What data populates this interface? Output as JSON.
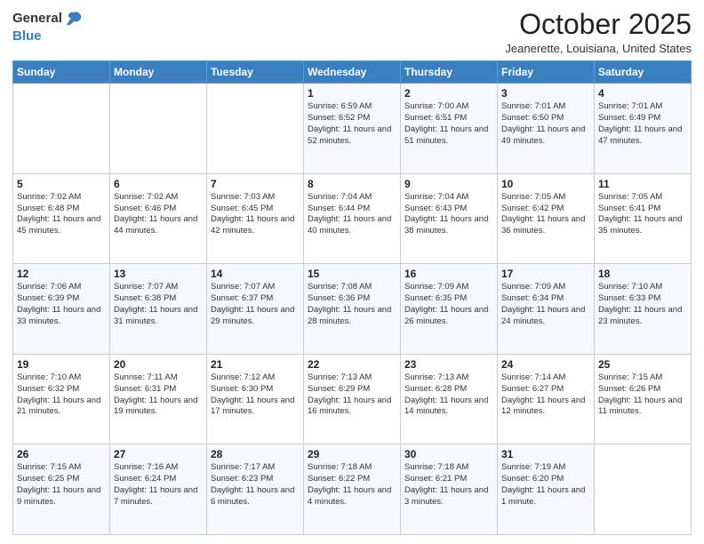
{
  "header": {
    "logo_general": "General",
    "logo_blue": "Blue",
    "month": "October 2025",
    "location": "Jeanerette, Louisiana, United States"
  },
  "weekdays": [
    "Sunday",
    "Monday",
    "Tuesday",
    "Wednesday",
    "Thursday",
    "Friday",
    "Saturday"
  ],
  "weeks": [
    [
      {
        "day": "",
        "info": ""
      },
      {
        "day": "",
        "info": ""
      },
      {
        "day": "",
        "info": ""
      },
      {
        "day": "1",
        "info": "Sunrise: 6:59 AM\nSunset: 6:52 PM\nDaylight: 11 hours and 52 minutes."
      },
      {
        "day": "2",
        "info": "Sunrise: 7:00 AM\nSunset: 6:51 PM\nDaylight: 11 hours and 51 minutes."
      },
      {
        "day": "3",
        "info": "Sunrise: 7:01 AM\nSunset: 6:50 PM\nDaylight: 11 hours and 49 minutes."
      },
      {
        "day": "4",
        "info": "Sunrise: 7:01 AM\nSunset: 6:49 PM\nDaylight: 11 hours and 47 minutes."
      }
    ],
    [
      {
        "day": "5",
        "info": "Sunrise: 7:02 AM\nSunset: 6:48 PM\nDaylight: 11 hours and 45 minutes."
      },
      {
        "day": "6",
        "info": "Sunrise: 7:02 AM\nSunset: 6:46 PM\nDaylight: 11 hours and 44 minutes."
      },
      {
        "day": "7",
        "info": "Sunrise: 7:03 AM\nSunset: 6:45 PM\nDaylight: 11 hours and 42 minutes."
      },
      {
        "day": "8",
        "info": "Sunrise: 7:04 AM\nSunset: 6:44 PM\nDaylight: 11 hours and 40 minutes."
      },
      {
        "day": "9",
        "info": "Sunrise: 7:04 AM\nSunset: 6:43 PM\nDaylight: 11 hours and 38 minutes."
      },
      {
        "day": "10",
        "info": "Sunrise: 7:05 AM\nSunset: 6:42 PM\nDaylight: 11 hours and 36 minutes."
      },
      {
        "day": "11",
        "info": "Sunrise: 7:05 AM\nSunset: 6:41 PM\nDaylight: 11 hours and 35 minutes."
      }
    ],
    [
      {
        "day": "12",
        "info": "Sunrise: 7:06 AM\nSunset: 6:39 PM\nDaylight: 11 hours and 33 minutes."
      },
      {
        "day": "13",
        "info": "Sunrise: 7:07 AM\nSunset: 6:38 PM\nDaylight: 11 hours and 31 minutes."
      },
      {
        "day": "14",
        "info": "Sunrise: 7:07 AM\nSunset: 6:37 PM\nDaylight: 11 hours and 29 minutes."
      },
      {
        "day": "15",
        "info": "Sunrise: 7:08 AM\nSunset: 6:36 PM\nDaylight: 11 hours and 28 minutes."
      },
      {
        "day": "16",
        "info": "Sunrise: 7:09 AM\nSunset: 6:35 PM\nDaylight: 11 hours and 26 minutes."
      },
      {
        "day": "17",
        "info": "Sunrise: 7:09 AM\nSunset: 6:34 PM\nDaylight: 11 hours and 24 minutes."
      },
      {
        "day": "18",
        "info": "Sunrise: 7:10 AM\nSunset: 6:33 PM\nDaylight: 11 hours and 23 minutes."
      }
    ],
    [
      {
        "day": "19",
        "info": "Sunrise: 7:10 AM\nSunset: 6:32 PM\nDaylight: 11 hours and 21 minutes."
      },
      {
        "day": "20",
        "info": "Sunrise: 7:11 AM\nSunset: 6:31 PM\nDaylight: 11 hours and 19 minutes."
      },
      {
        "day": "21",
        "info": "Sunrise: 7:12 AM\nSunset: 6:30 PM\nDaylight: 11 hours and 17 minutes."
      },
      {
        "day": "22",
        "info": "Sunrise: 7:13 AM\nSunset: 6:29 PM\nDaylight: 11 hours and 16 minutes."
      },
      {
        "day": "23",
        "info": "Sunrise: 7:13 AM\nSunset: 6:28 PM\nDaylight: 11 hours and 14 minutes."
      },
      {
        "day": "24",
        "info": "Sunrise: 7:14 AM\nSunset: 6:27 PM\nDaylight: 11 hours and 12 minutes."
      },
      {
        "day": "25",
        "info": "Sunrise: 7:15 AM\nSunset: 6:26 PM\nDaylight: 11 hours and 11 minutes."
      }
    ],
    [
      {
        "day": "26",
        "info": "Sunrise: 7:15 AM\nSunset: 6:25 PM\nDaylight: 11 hours and 9 minutes."
      },
      {
        "day": "27",
        "info": "Sunrise: 7:16 AM\nSunset: 6:24 PM\nDaylight: 11 hours and 7 minutes."
      },
      {
        "day": "28",
        "info": "Sunrise: 7:17 AM\nSunset: 6:23 PM\nDaylight: 11 hours and 6 minutes."
      },
      {
        "day": "29",
        "info": "Sunrise: 7:18 AM\nSunset: 6:22 PM\nDaylight: 11 hours and 4 minutes."
      },
      {
        "day": "30",
        "info": "Sunrise: 7:18 AM\nSunset: 6:21 PM\nDaylight: 11 hours and 3 minutes."
      },
      {
        "day": "31",
        "info": "Sunrise: 7:19 AM\nSunset: 6:20 PM\nDaylight: 11 hours and 1 minute."
      },
      {
        "day": "",
        "info": ""
      }
    ]
  ]
}
